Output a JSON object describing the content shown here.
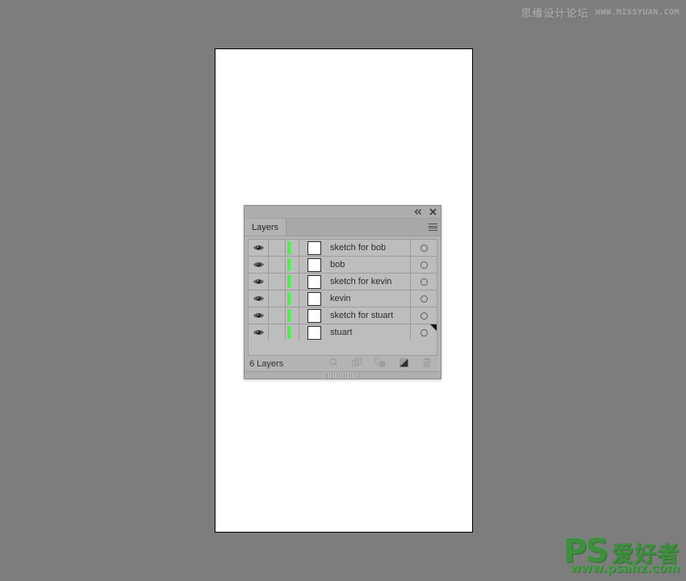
{
  "watermarks": {
    "top_cn": "思缘设计论坛",
    "top_url": "WWW.MISSYUAN.COM",
    "logo_mark": "PS",
    "logo_cn": "爱好者",
    "logo_url": "www.psahz.com"
  },
  "canvas": {
    "background_color": "#7d7d7d",
    "artboard_color": "#ffffff"
  },
  "panel": {
    "titlebar": {
      "collapse_icon": "double-chevron-left-icon",
      "close_icon": "close-icon"
    },
    "tab_label": "Layers",
    "menu_icon": "hamburger-menu-icon",
    "columns": {
      "visibility": "eye-icon",
      "lock": "",
      "color": "",
      "thumbnail": "",
      "name": "",
      "target": "target-circle-icon"
    },
    "layers": [
      {
        "name": "sketch for bob",
        "visible": true,
        "locked": false,
        "color": "#4cf04c",
        "selected": false
      },
      {
        "name": "bob",
        "visible": true,
        "locked": false,
        "color": "#4cf04c",
        "selected": false
      },
      {
        "name": "sketch for kevin",
        "visible": true,
        "locked": false,
        "color": "#4cf04c",
        "selected": false
      },
      {
        "name": "kevin",
        "visible": true,
        "locked": false,
        "color": "#4cf04c",
        "selected": false
      },
      {
        "name": "sketch for stuart",
        "visible": true,
        "locked": false,
        "color": "#4cf04c",
        "selected": false
      },
      {
        "name": "stuart",
        "visible": true,
        "locked": false,
        "color": "#4cf04c",
        "selected": false
      }
    ],
    "footer": {
      "count_label": "6 Layers",
      "buttons": [
        {
          "name": "locate-object-button",
          "icon": "magnifier-icon"
        },
        {
          "name": "make-release-clipping-mask",
          "icon": "clipping-mask-icon"
        },
        {
          "name": "create-new-sublayer-button",
          "icon": "new-sublayer-icon"
        },
        {
          "name": "create-new-layer-button",
          "icon": "new-layer-icon"
        },
        {
          "name": "delete-selection-button",
          "icon": "trash-icon"
        }
      ]
    }
  }
}
